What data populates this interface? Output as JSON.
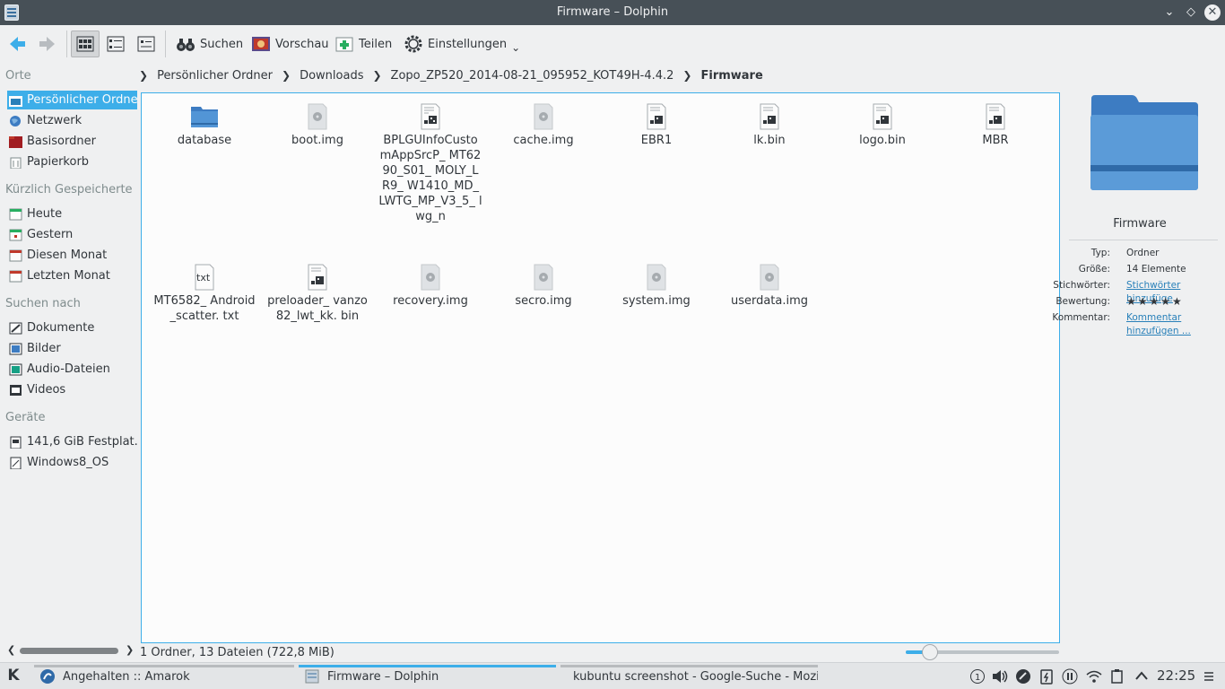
{
  "window": {
    "title": "Firmware – Dolphin"
  },
  "toolbar": {
    "search_label": "Suchen",
    "preview_label": "Vorschau",
    "share_label": "Teilen",
    "settings_label": "Einstellungen"
  },
  "breadcrumb": [
    "Persönlicher Ordner",
    "Downloads",
    "Zopo_ZP520_2014-08-21_095952_KOT49H-4.4.2",
    "Firmware"
  ],
  "places": {
    "sections": [
      {
        "title": "Orte",
        "items": [
          {
            "label": "Persönlicher Ordner",
            "icon": "home-folder-icon",
            "active": true
          },
          {
            "label": "Netzwerk",
            "icon": "network-globe-icon"
          },
          {
            "label": "Basisordner",
            "icon": "root-folder-icon"
          },
          {
            "label": "Papierkorb",
            "icon": "trash-icon"
          }
        ]
      },
      {
        "title": "Kürzlich Gespeicherte",
        "items": [
          {
            "label": "Heute",
            "icon": "calendar-today-icon"
          },
          {
            "label": "Gestern",
            "icon": "calendar-yesterday-icon"
          },
          {
            "label": "Diesen Monat",
            "icon": "calendar-month-icon"
          },
          {
            "label": "Letzten Monat",
            "icon": "calendar-last-month-icon"
          }
        ]
      },
      {
        "title": "Suchen nach",
        "items": [
          {
            "label": "Dokumente",
            "icon": "documents-icon"
          },
          {
            "label": "Bilder",
            "icon": "images-icon"
          },
          {
            "label": "Audio-Dateien",
            "icon": "audio-icon"
          },
          {
            "label": "Videos",
            "icon": "video-icon"
          }
        ]
      },
      {
        "title": "Geräte",
        "items": [
          {
            "label": "141,6 GiB Festplat...",
            "icon": "hard-disk-icon"
          },
          {
            "label": "Windows8_OS",
            "icon": "drive-icon"
          }
        ]
      }
    ]
  },
  "files": [
    {
      "name": "database",
      "icon": "folder-icon"
    },
    {
      "name": "boot.img",
      "icon": "disk-image-icon"
    },
    {
      "name": "BPLGUInfoCusto mAppSrcP_ MT6290_S01_ MOLY_LR9_ W1410_MD_ LWTG_MP_V3_5_ lwg_n",
      "icon": "binary-file-icon"
    },
    {
      "name": "cache.img",
      "icon": "disk-image-icon"
    },
    {
      "name": "EBR1",
      "icon": "binary-file-icon"
    },
    {
      "name": "lk.bin",
      "icon": "binary-file-icon"
    },
    {
      "name": "logo.bin",
      "icon": "binary-file-icon"
    },
    {
      "name": "MBR",
      "icon": "binary-file-icon"
    },
    {
      "name": "MT6582_ Android_scatter. txt",
      "icon": "text-file-icon"
    },
    {
      "name": "preloader_ vanzo82_lwt_kk. bin",
      "icon": "binary-file-icon"
    },
    {
      "name": "recovery.img",
      "icon": "disk-image-icon"
    },
    {
      "name": "secro.img",
      "icon": "disk-image-icon"
    },
    {
      "name": "system.img",
      "icon": "disk-image-icon"
    },
    {
      "name": "userdata.img",
      "icon": "disk-image-icon"
    }
  ],
  "info_panel": {
    "name": "Firmware",
    "rows": [
      {
        "key": "Typ:",
        "value": "Ordner"
      },
      {
        "key": "Größe:",
        "value": "14 Elemente"
      },
      {
        "key": "Stichwörter:",
        "value": "Stichwörter hinzufüge",
        "link": true
      },
      {
        "key": "Bewertung:",
        "value": "★★★★★"
      },
      {
        "key": "Kommentar:",
        "value": "Kommentar hinzufügen ...",
        "link": true
      }
    ]
  },
  "status": {
    "text": "1 Ordner, 13 Dateien (722,8 MiB)",
    "zoom_fraction": 0.16
  },
  "taskbar": {
    "tasks": [
      {
        "label": "Angehalten  ::  Amarok",
        "icon": "amarok-icon"
      },
      {
        "label": "Firmware – Dolphin",
        "icon": "dolphin-icon",
        "active": true
      },
      {
        "label": "kubuntu screenshot - Google-Suche - Mozil",
        "icon": "firefox-icon"
      }
    ],
    "tray_badge": "1",
    "clock": "22:25"
  },
  "colors": {
    "accent": "#3daee9",
    "titlebar": "#475057",
    "folder": "#3d7cc2"
  }
}
